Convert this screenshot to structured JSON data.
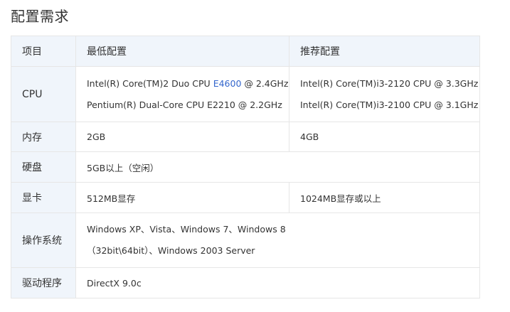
{
  "section_title": "配置需求",
  "table": {
    "headers": [
      "项目",
      "最低配置",
      "推荐配置"
    ],
    "cpu": {
      "label": "CPU",
      "min_line1_prefix": "Intel(R) Core(TM)2 Duo CPU ",
      "min_line1_link": "E4600",
      "min_line1_suffix": " @ 2.4GHz",
      "min_line2": "Pentium(R) Dual-Core CPU E2210 @ 2.2GHz",
      "rec_line1": "Intel(R) Core(TM)i3-2120 CPU @ 3.3GHz",
      "rec_line2": "Intel(R) Core(TM)i3-2100 CPU @ 3.1GHz"
    },
    "memory": {
      "label": "内存",
      "min": "2GB",
      "rec": "4GB"
    },
    "disk": {
      "label": "硬盘",
      "value": "5GB以上（空闲）"
    },
    "gpu": {
      "label": "显卡",
      "min": "512MB显存",
      "rec": "1024MB显存或以上"
    },
    "os": {
      "label": "操作系统",
      "line1": "Windows XP、Vista、Windows 7、Windows 8",
      "line2": "（32bit\\64bit）、Windows 2003 Server"
    },
    "driver": {
      "label": "驱动程序",
      "value": "DirectX 9.0c"
    }
  }
}
